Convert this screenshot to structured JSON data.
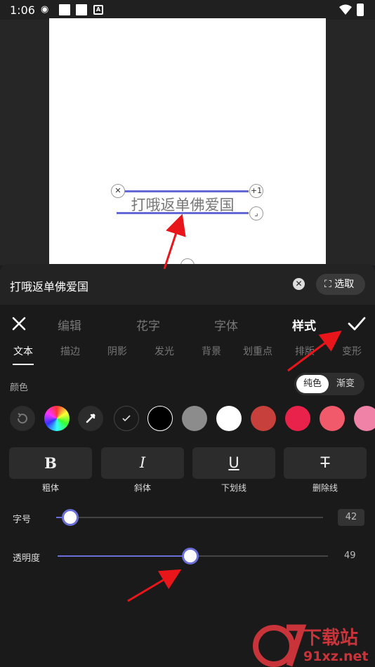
{
  "status": {
    "time": "1:06",
    "a_badge": "A"
  },
  "canvas": {
    "text": "打哦返单佛爱国"
  },
  "text_input": {
    "value": "打哦返单佛爱国",
    "select_label": "⛶ 选取"
  },
  "main_tabs": [
    "编辑",
    "花字",
    "字体",
    "样式"
  ],
  "active_main_tab": "样式",
  "sub_tabs": [
    "文本",
    "描边",
    "阴影",
    "发光",
    "背景",
    "划重点",
    "排版",
    "变形"
  ],
  "active_sub_tab": "文本",
  "color_section": {
    "label": "颜色",
    "modes": [
      "纯色",
      "渐变"
    ],
    "active_mode": "纯色"
  },
  "swatches": [
    "#000000",
    "#8c8c8c",
    "#ffffff",
    "#c8403c",
    "#e8224a",
    "#f05a6a",
    "#f082a8"
  ],
  "format_buttons": [
    {
      "glyph": "B",
      "label": "粗体"
    },
    {
      "glyph": "I",
      "label": "斜体"
    },
    {
      "glyph": "U",
      "label": "下划线"
    },
    {
      "glyph": "T",
      "label": "删除线"
    }
  ],
  "font_size": {
    "label": "字号",
    "value": "42"
  },
  "opacity": {
    "label": "透明度",
    "value": "49"
  },
  "watermark": {
    "name": "下载站",
    "url": "91xz.net"
  },
  "colors": {
    "accent": "#6a6fd8",
    "arrow": "#e8161b"
  }
}
